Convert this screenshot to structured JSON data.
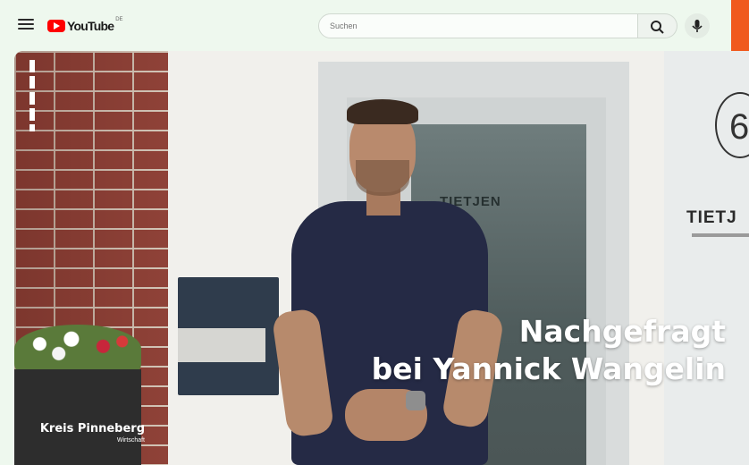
{
  "header": {
    "logo_text": "YouTube",
    "logo_region": "DE",
    "search_placeholder": "Suchen",
    "icons": [
      "menu-icon",
      "search-icon",
      "mic-icon"
    ],
    "brand_color": "#ff0000",
    "accent_color": "#f05a1e"
  },
  "video": {
    "headline_line1": "Nachgefragt",
    "headline_line2": "bei Yannick Wangelin",
    "region": "Kreis Pinneberg",
    "category": "Wirtschaft",
    "door_sign": "TIETJEN",
    "wall_sign": "TIETJ",
    "house_number": "6"
  }
}
